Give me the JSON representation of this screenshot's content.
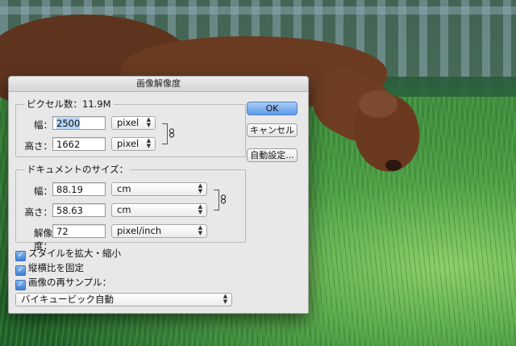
{
  "dialog": {
    "title": "画像解像度",
    "pixel_group": {
      "legend": "ピクセル数：11.9M",
      "width_label": "幅：",
      "width_value": "2500",
      "width_unit": "pixel",
      "height_label": "高さ：",
      "height_value": "1662",
      "height_unit": "pixel"
    },
    "document_group": {
      "legend": "ドキュメントのサイズ：",
      "width_label": "幅：",
      "width_value": "88.19",
      "width_unit": "cm",
      "height_label": "高さ：",
      "height_value": "58.63",
      "height_unit": "cm",
      "resolution_label": "解像度：",
      "resolution_value": "72",
      "resolution_unit": "pixel/inch"
    },
    "buttons": {
      "ok": "OK",
      "cancel": "キャンセル",
      "auto": "自動設定..."
    },
    "checkboxes": [
      {
        "label": "スタイルを拡大・縮小",
        "checked": true
      },
      {
        "label": "縦横比を固定",
        "checked": true
      },
      {
        "label": "画像の再サンプル：",
        "checked": true
      }
    ],
    "resample_method": "バイキュービック自動",
    "colors": {
      "accent": "#5e9be8",
      "dialog_bg": "#e8e8e8"
    },
    "icons": [
      "chain-link-icon",
      "popup-arrows-icon",
      "checkmark-icon"
    ]
  }
}
